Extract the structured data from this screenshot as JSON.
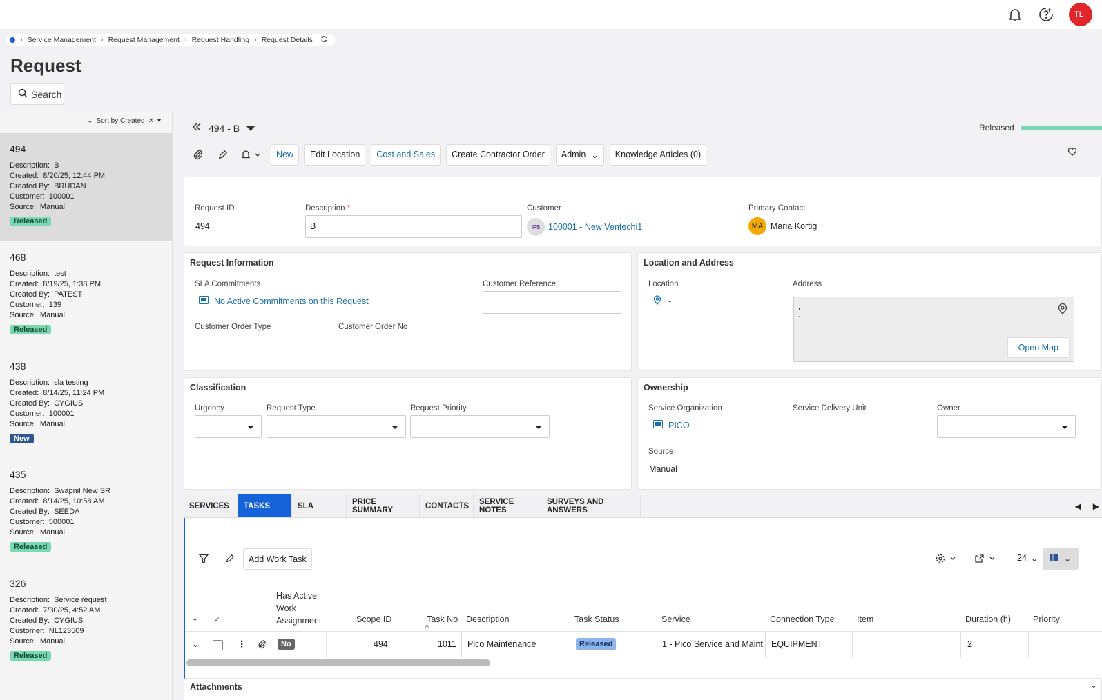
{
  "topbar": {
    "avatar": "TL",
    "bell_icon": "bell-icon",
    "help_icon": "help-icon"
  },
  "breadcrumb": [
    "Service Management",
    "Request Management",
    "Request Handling",
    "Request Details"
  ],
  "page": {
    "title": "Request",
    "search_label": "Search"
  },
  "list": {
    "sort_label": "Sort by Created",
    "labels": {
      "description": "Description:",
      "created": "Created:",
      "created_by": "Created By:",
      "customer": "Customer:",
      "source": "Source:"
    },
    "items": [
      {
        "id": "494",
        "description": "B",
        "created": "8/20/25, 12:44 PM",
        "created_by": "BRUDAN",
        "customer": "100001",
        "source": "Manual",
        "status": "Released"
      },
      {
        "id": "468",
        "description": "test",
        "created": "8/19/25, 1:38 PM",
        "created_by": "PATEST",
        "customer": "139",
        "source": "Manual",
        "status": "Released"
      },
      {
        "id": "438",
        "description": "sla testing",
        "created": "8/14/25, 11:24 PM",
        "created_by": "CYGIUS",
        "customer": "100001",
        "source": "Manual",
        "status": "New"
      },
      {
        "id": "435",
        "description": "Swapnil New SR",
        "created": "8/14/25, 10:58 AM",
        "created_by": "SEEDA",
        "customer": "500001",
        "source": "Manual",
        "status": "Released"
      },
      {
        "id": "326",
        "description": "Service request",
        "created": "7/30/25, 4:52 AM",
        "created_by": "CYGIUS",
        "customer": "NL123509",
        "source": "Manual",
        "status": "Released"
      }
    ]
  },
  "record": {
    "title": "494 - B",
    "status": "Released",
    "toolbar": {
      "new": "New",
      "edit_location": "Edit Location",
      "cost_sales": "Cost and Sales",
      "contractor": "Create Contractor Order",
      "admin": "Admin",
      "knowledge": "Knowledge Articles (0)"
    },
    "header": {
      "request_id_label": "Request ID",
      "request_id": "494",
      "description_label": "Description",
      "required": "*",
      "description": "B",
      "customer_label": "Customer",
      "customer_logo": "IFS",
      "customer": "100001 - New Ventechi1",
      "contact_label": "Primary Contact",
      "contact_initials": "MA",
      "contact": "Maria Kortig"
    },
    "request_info": {
      "title": "Request Information",
      "sla_label": "SLA Commitments",
      "sla": "No Active Commitments on this Request",
      "cust_ref_label": "Customer Reference",
      "cust_ref": "",
      "order_type_label": "Customer Order Type",
      "order_no_label": "Customer Order No"
    },
    "location": {
      "title": "Location and Address",
      "location_label": "Location",
      "location": "-",
      "address_label": "Address",
      "address_line1": ",",
      "address_line2": "-",
      "open_map": "Open Map"
    },
    "classification": {
      "title": "Classification",
      "urgency": "Urgency",
      "type": "Request Type",
      "priority": "Request Priority"
    },
    "ownership": {
      "title": "Ownership",
      "org_label": "Service Organization",
      "org": "PICO",
      "sdu_label": "Service Delivery Unit",
      "owner_label": "Owner",
      "source_label": "Source",
      "source": "Manual"
    }
  },
  "tabs": [
    "SERVICES",
    "TASKS",
    "SLA",
    "PRICE SUMMARY",
    "CONTACTS",
    "SERVICE NOTES",
    "SURVEYS AND ANSWERS"
  ],
  "tasks": {
    "add_label": "Add Work Task",
    "page_size": "24",
    "columns": {
      "active": [
        "Has Active",
        "Work",
        "Assignment"
      ],
      "scope": "Scope ID",
      "task_no": "Task No",
      "description": "Description",
      "status": "Task Status",
      "service": "Service",
      "conn": "Connection Type",
      "item": "Item",
      "duration": "Duration (h)",
      "priority": "Priority"
    },
    "rows": [
      {
        "active": "No",
        "scope": "494",
        "task_no": "1011",
        "description": "Pico Maintenance",
        "status": "Released",
        "service": "1 - Pico Service and Maint",
        "conn": "EQUIPMENT",
        "item": "",
        "duration": "2",
        "priority": ""
      }
    ]
  },
  "attachments_label": "Attachments"
}
